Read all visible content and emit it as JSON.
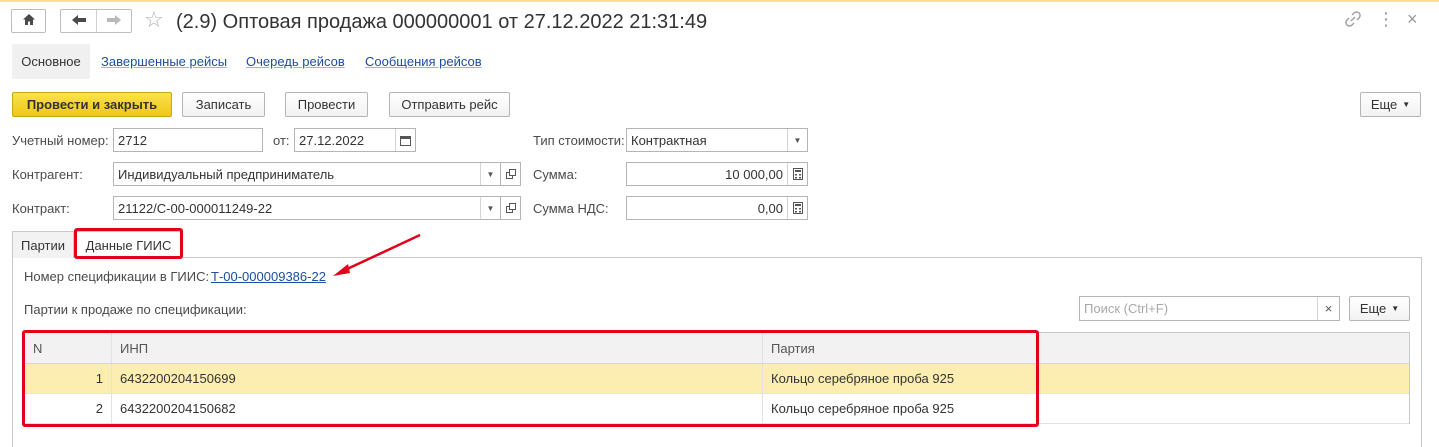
{
  "window": {
    "title": "(2.9) Оптовая продажа 000000001 от 27.12.2022 21:31:49"
  },
  "top_tabs": {
    "active": "Основное",
    "links": [
      "Завершенные рейсы",
      "Очередь рейсов",
      "Сообщения рейсов"
    ]
  },
  "toolbar": {
    "post_close": "Провести и закрыть",
    "save": "Записать",
    "post": "Провести",
    "send_trip": "Отправить рейс",
    "more": "Еще"
  },
  "form": {
    "account_number_label": "Учетный номер:",
    "account_number": "2712",
    "date_label": "от:",
    "date": "27.12.2022",
    "cost_type_label": "Тип стоимости:",
    "cost_type": "Контрактная",
    "counterparty_label": "Контрагент:",
    "counterparty": "Индивидуальный предприниматель",
    "sum_label": "Сумма:",
    "sum": "10 000,00",
    "contract_label": "Контракт:",
    "contract": "21122/С-00-000011249-22",
    "vat_label": "Сумма НДС:",
    "vat": "0,00"
  },
  "sub_tabs": {
    "batches": "Партии",
    "giis_data": "Данные ГИИС"
  },
  "giis": {
    "spec_label": "Номер спецификации в ГИИС:",
    "spec_number": "Т-00-000009386-22",
    "batches_label": "Партии к продаже по спецификации:",
    "search_placeholder": "Поиск (Ctrl+F)",
    "more": "Еще"
  },
  "table": {
    "headers": [
      "N",
      "ИНП",
      "Партия"
    ],
    "rows": [
      {
        "n": "1",
        "inp": "6432200204150699",
        "batch": "Кольцо серебряное проба 925"
      },
      {
        "n": "2",
        "inp": "6432200204150682",
        "batch": "Кольцо серебряное проба 925"
      }
    ]
  },
  "colors": {
    "primary_button": "#f5d42f",
    "highlight": "#e3001b",
    "selected_row": "#fbeeb0",
    "link": "#1d4ea0"
  }
}
